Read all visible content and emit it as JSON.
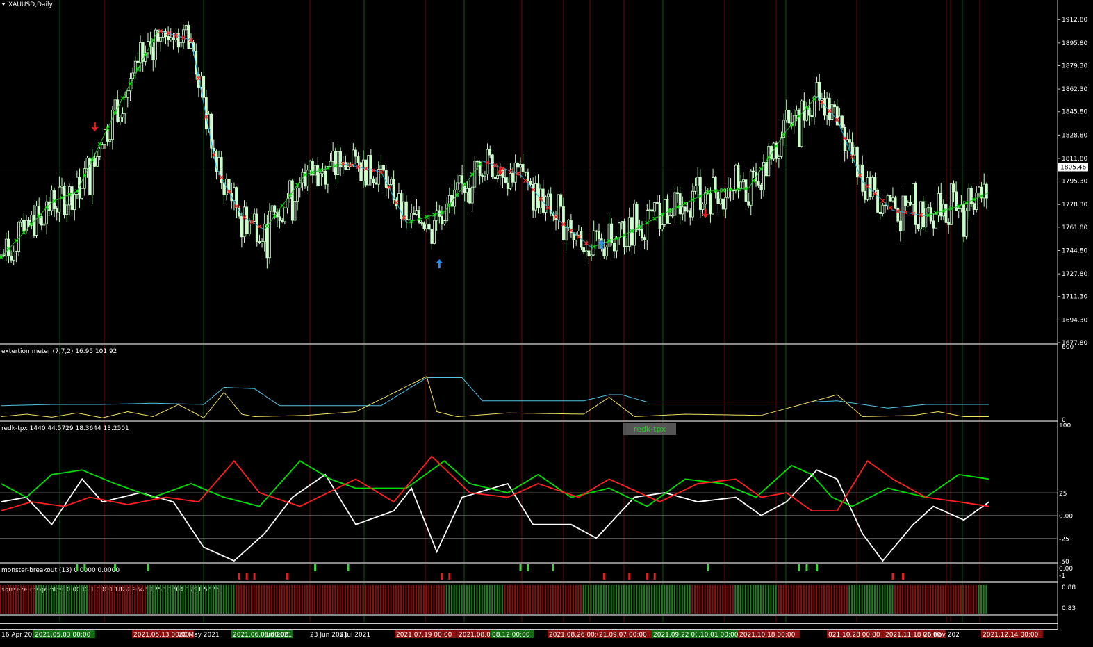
{
  "chart_data": [
    {
      "type": "candlestick",
      "title": "XAUUSD,Daily",
      "symbol": "XAUUSD",
      "timeframe": "Daily",
      "ylim": [
        1677.8,
        1921.0
      ],
      "y_ticks": [
        "1912.80",
        "1895.80",
        "1879.30",
        "1862.30",
        "1845.80",
        "1828.80",
        "1811.80",
        "1795.30",
        "1778.30",
        "1761.80",
        "1744.80",
        "1727.80",
        "1711.30",
        "1694.30",
        "1677.80"
      ],
      "current_price": "1805.46",
      "x_ticks": [
        "16 Apr 2021",
        "2021.05.03 00:00",
        "2021.05.13 00:00",
        "20 May 2021",
        "2021.06.08 00:00",
        "un 2021",
        "23 Jun 2021",
        "5 Jul 2021",
        "2021.07.19 00:00",
        "2021.08.03 00:00",
        "08.12 00:00",
        "2021.08.26 00:00",
        "21.09.07 00:00",
        "2021.09.22 00:00",
        ".10.01 00:00",
        "2021.10.18 00:00",
        "021.10.28 00:00",
        "2021.11.18 00:00",
        "26 Nov 202",
        "2021.12.14 00:00"
      ],
      "trend_line_key_points": [
        [
          0,
          1740
        ],
        [
          20,
          1780
        ],
        [
          30,
          1788
        ],
        [
          45,
          1845
        ],
        [
          62,
          1905
        ],
        [
          75,
          1898
        ],
        [
          85,
          1805
        ],
        [
          95,
          1770
        ],
        [
          104,
          1760
        ],
        [
          120,
          1800
        ],
        [
          135,
          1808
        ],
        [
          150,
          1802
        ],
        [
          160,
          1765
        ],
        [
          175,
          1773
        ],
        [
          190,
          1810
        ],
        [
          205,
          1800
        ],
        [
          220,
          1767
        ],
        [
          233,
          1747
        ],
        [
          245,
          1755
        ],
        [
          262,
          1772
        ],
        [
          280,
          1788
        ],
        [
          295,
          1790
        ],
        [
          310,
          1832
        ],
        [
          322,
          1857
        ],
        [
          330,
          1840
        ],
        [
          340,
          1795
        ],
        [
          352,
          1774
        ],
        [
          365,
          1770
        ],
        [
          378,
          1777
        ],
        [
          390,
          1787
        ]
      ],
      "signals": [
        {
          "type": "sell-arrow",
          "color": "#e02020",
          "bar": 37,
          "price": 1835
        },
        {
          "type": "buy-arrow",
          "color": "#2f8de8",
          "bar": 173,
          "price": 1735
        },
        {
          "type": "sell-arrow",
          "color": "#e02020",
          "bar": 197,
          "price": 1803
        },
        {
          "type": "buy-arrow",
          "color": "#2f8de8",
          "bar": 237,
          "price": 1749
        },
        {
          "type": "sell-arrow",
          "color": "#e02020",
          "bar": 278,
          "price": 1772
        }
      ],
      "colors": {
        "bull": "#ccffcc",
        "bear": "#ccffcc",
        "trend_up": "#00e000",
        "trend_down": "#ff2020"
      }
    },
    {
      "type": "line",
      "title": "extertion meter (7,7,2) 16.95 101.92",
      "ylim": [
        0,
        600
      ],
      "y_ticks": [
        "600",
        "0"
      ],
      "series": [
        {
          "color": "#4fc4e8",
          "key_points": [
            [
              0,
              110
            ],
            [
              20,
              120
            ],
            [
              40,
              120
            ],
            [
              60,
              130
            ],
            [
              80,
              120
            ],
            [
              88,
              260
            ],
            [
              100,
              250
            ],
            [
              110,
              110
            ],
            [
              150,
              110
            ],
            [
              168,
              340
            ],
            [
              182,
              340
            ],
            [
              190,
              150
            ],
            [
              230,
              150
            ],
            [
              240,
              200
            ],
            [
              245,
              200
            ],
            [
              255,
              140
            ],
            [
              320,
              140
            ],
            [
              330,
              150
            ],
            [
              350,
              90
            ],
            [
              365,
              120
            ],
            [
              380,
              120
            ]
          ]
        },
        {
          "color": "#f0e060",
          "key_points": [
            [
              0,
              20
            ],
            [
              10,
              40
            ],
            [
              20,
              15
            ],
            [
              30,
              50
            ],
            [
              40,
              10
            ],
            [
              50,
              60
            ],
            [
              60,
              20
            ],
            [
              70,
              120
            ],
            [
              80,
              10
            ],
            [
              88,
              220
            ],
            [
              95,
              40
            ],
            [
              100,
              20
            ],
            [
              120,
              30
            ],
            [
              140,
              60
            ],
            [
              168,
              350
            ],
            [
              172,
              60
            ],
            [
              180,
              20
            ],
            [
              200,
              50
            ],
            [
              230,
              40
            ],
            [
              240,
              180
            ],
            [
              250,
              20
            ],
            [
              270,
              40
            ],
            [
              300,
              30
            ],
            [
              330,
              200
            ],
            [
              340,
              20
            ],
            [
              360,
              30
            ],
            [
              370,
              60
            ],
            [
              380,
              20
            ]
          ]
        }
      ]
    },
    {
      "type": "line",
      "title": "redk-tpx 1440 44.5729 18.3644 13.2501",
      "badge": "redk-tpx",
      "ylim": [
        -50,
        100
      ],
      "y_ticks": [
        "100",
        "25",
        "0.00",
        "-25",
        "-50"
      ],
      "series": [
        {
          "color": "#ffffff",
          "key_points": [
            [
              0,
              15
            ],
            [
              10,
              20
            ],
            [
              20,
              -10
            ],
            [
              32,
              40
            ],
            [
              40,
              15
            ],
            [
              55,
              25
            ],
            [
              68,
              15
            ],
            [
              80,
              -35
            ],
            [
              92,
              -50
            ],
            [
              104,
              -20
            ],
            [
              115,
              20
            ],
            [
              128,
              45
            ],
            [
              140,
              -10
            ],
            [
              155,
              5
            ],
            [
              162,
              30
            ],
            [
              172,
              -40
            ],
            [
              182,
              20
            ],
            [
              200,
              35
            ],
            [
              210,
              -10
            ],
            [
              225,
              -10
            ],
            [
              235,
              -25
            ],
            [
              250,
              20
            ],
            [
              262,
              25
            ],
            [
              275,
              15
            ],
            [
              290,
              20
            ],
            [
              300,
              0
            ],
            [
              310,
              15
            ],
            [
              322,
              50
            ],
            [
              330,
              40
            ],
            [
              340,
              -20
            ],
            [
              348,
              -50
            ],
            [
              360,
              -10
            ],
            [
              368,
              10
            ],
            [
              380,
              -5
            ],
            [
              390,
              15
            ]
          ]
        },
        {
          "color": "#00e000",
          "key_points": [
            [
              0,
              35
            ],
            [
              10,
              20
            ],
            [
              20,
              45
            ],
            [
              32,
              50
            ],
            [
              45,
              35
            ],
            [
              60,
              20
            ],
            [
              75,
              35
            ],
            [
              88,
              20
            ],
            [
              102,
              10
            ],
            [
              118,
              60
            ],
            [
              130,
              40
            ],
            [
              140,
              30
            ],
            [
              160,
              30
            ],
            [
              175,
              60
            ],
            [
              185,
              35
            ],
            [
              200,
              25
            ],
            [
              212,
              45
            ],
            [
              225,
              20
            ],
            [
              240,
              30
            ],
            [
              255,
              10
            ],
            [
              270,
              40
            ],
            [
              285,
              35
            ],
            [
              298,
              20
            ],
            [
              312,
              55
            ],
            [
              320,
              45
            ],
            [
              328,
              20
            ],
            [
              336,
              10
            ],
            [
              350,
              30
            ],
            [
              365,
              20
            ],
            [
              378,
              45
            ],
            [
              390,
              40
            ]
          ]
        },
        {
          "color": "#ff2020",
          "key_points": [
            [
              0,
              5
            ],
            [
              12,
              15
            ],
            [
              25,
              10
            ],
            [
              35,
              20
            ],
            [
              50,
              12
            ],
            [
              65,
              20
            ],
            [
              78,
              15
            ],
            [
              92,
              60
            ],
            [
              102,
              25
            ],
            [
              118,
              10
            ],
            [
              140,
              40
            ],
            [
              155,
              15
            ],
            [
              170,
              65
            ],
            [
              185,
              25
            ],
            [
              200,
              20
            ],
            [
              212,
              35
            ],
            [
              228,
              20
            ],
            [
              240,
              40
            ],
            [
              260,
              15
            ],
            [
              275,
              35
            ],
            [
              290,
              40
            ],
            [
              300,
              20
            ],
            [
              310,
              25
            ],
            [
              320,
              5
            ],
            [
              330,
              5
            ],
            [
              342,
              60
            ],
            [
              352,
              40
            ],
            [
              365,
              20
            ],
            [
              378,
              15
            ],
            [
              390,
              10
            ]
          ]
        }
      ]
    },
    {
      "type": "bar",
      "title": "monster-breakout (13) 0.0000 0.0000",
      "y_ticks": [
        "0.00",
        "-1"
      ],
      "up_bars": [
        30,
        33,
        45,
        58,
        124,
        137,
        205,
        208,
        218,
        279,
        315,
        318,
        322
      ],
      "down_bars": [
        94,
        97,
        100,
        113,
        174,
        177,
        238,
        248,
        255,
        258,
        352,
        356
      ],
      "colors": {
        "up": "#40d040",
        "down": "#e02020"
      }
    },
    {
      "type": "bar",
      "title": "squeeze-rnage-filter 0.0000 1.0000 1824.9646 1758.1704 1791.5675",
      "y_ticks": [
        "0.88",
        "0.83"
      ],
      "green_ranges": [
        [
          14,
          34
        ],
        [
          58,
          92
        ],
        [
          176,
          198
        ],
        [
          230,
          272
        ],
        [
          290,
          306
        ],
        [
          335,
          352
        ],
        [
          386,
          392
        ]
      ],
      "colors": {
        "green": "#208020",
        "red": "#8a1010"
      }
    }
  ]
}
